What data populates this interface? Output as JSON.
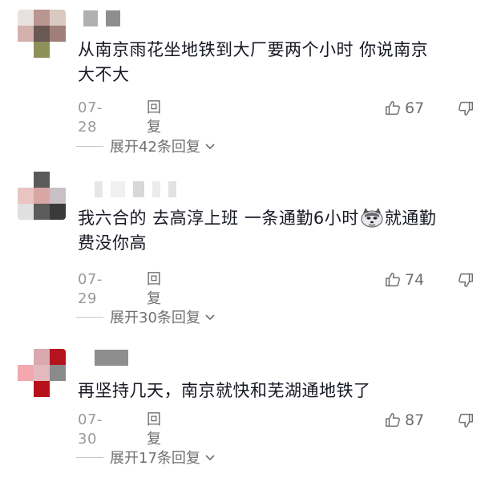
{
  "comments": [
    {
      "text": "从南京雨花坐地铁到大厂要两个小时 你说南京大不大",
      "text_line1": "从南京雨花坐地铁到大厂要两个小时 你说南京",
      "text_line2": "大不大",
      "date": "07-28",
      "reply_label": "回复",
      "likes": "67",
      "expand_label": "展开42条回复"
    },
    {
      "text_before_emoji": "我六合的 去高淳上班 一条通勤6小时",
      "text_after_emoji": "就通勤",
      "text_line2": "费没你高",
      "emoji_icon": "dog-emoji-icon",
      "date": "07-29",
      "reply_label": "回复",
      "likes": "74",
      "expand_label": "展开30条回复"
    },
    {
      "text": "再坚持几天，南京就快和芜湖通地铁了",
      "date": "07-30",
      "reply_label": "回复",
      "likes": "87",
      "expand_label": "展开17条回复"
    }
  ],
  "icons": {
    "like": "thumbs-up-icon",
    "dislike": "thumbs-down-icon",
    "expand": "chevron-down-icon"
  },
  "colors": {
    "text": "#161823",
    "meta_gray": "#9a9a9e",
    "action_gray": "#6f6f73"
  }
}
